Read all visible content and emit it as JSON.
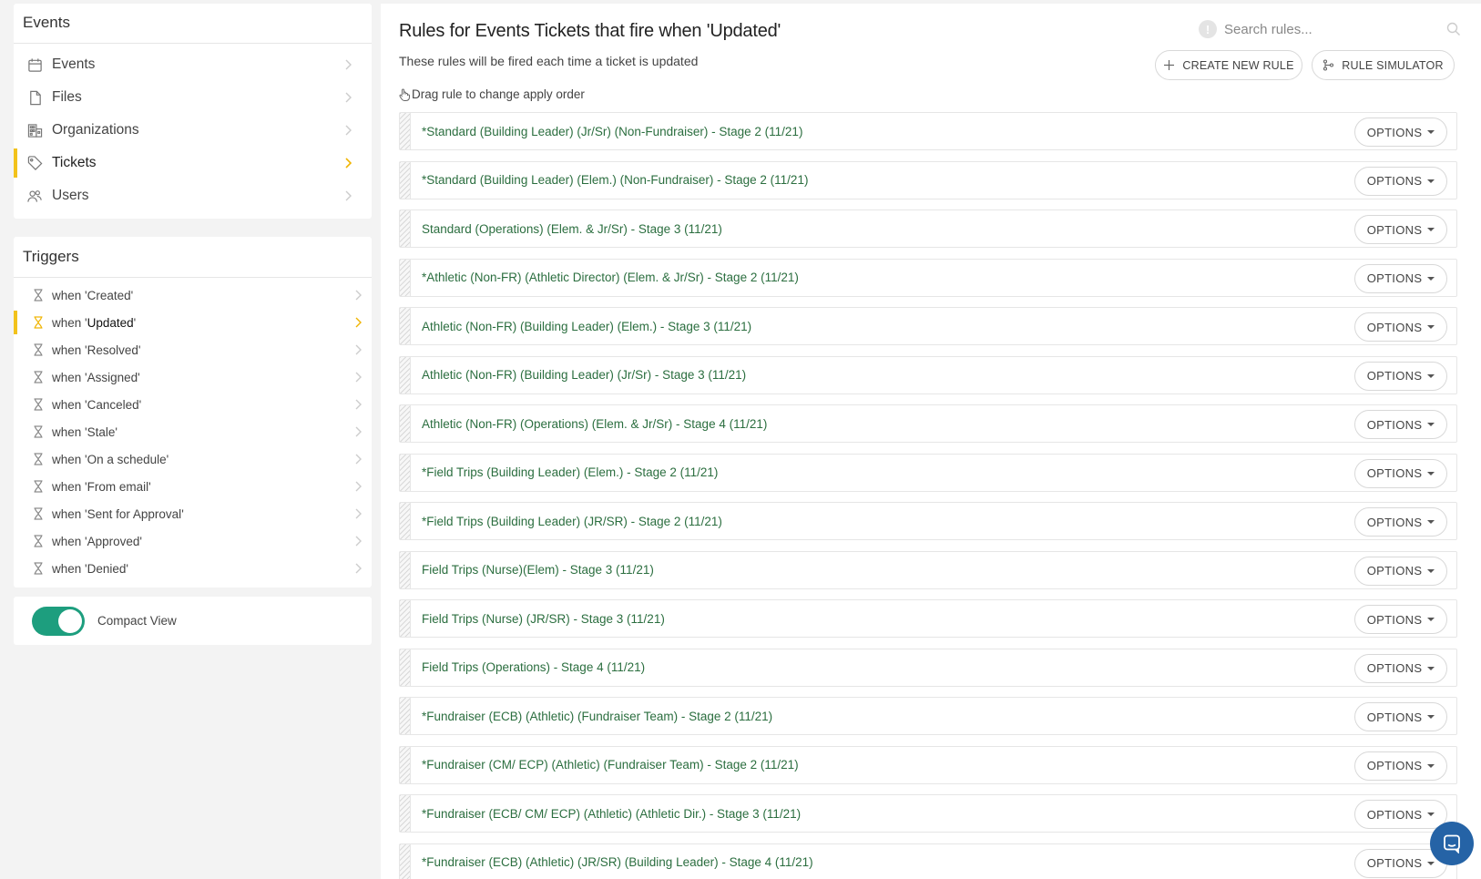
{
  "events_panel": {
    "title": "Events",
    "items": [
      {
        "label": "Events",
        "icon": "calendar-icon"
      },
      {
        "label": "Files",
        "icon": "file-icon"
      },
      {
        "label": "Organizations",
        "icon": "building-icon"
      },
      {
        "label": "Tickets",
        "icon": "tag-icon",
        "active": true
      },
      {
        "label": "Users",
        "icon": "users-icon"
      }
    ]
  },
  "triggers_panel": {
    "title": "Triggers",
    "prefix": "when",
    "items": [
      {
        "name": "Created"
      },
      {
        "name": "Updated",
        "active": true
      },
      {
        "name": "Resolved"
      },
      {
        "name": "Assigned"
      },
      {
        "name": "Canceled"
      },
      {
        "name": "Stale"
      },
      {
        "name": "On a schedule"
      },
      {
        "name": "From email"
      },
      {
        "name": "Sent for Approval"
      },
      {
        "name": "Approved"
      },
      {
        "name": "Denied"
      }
    ]
  },
  "compact_view": {
    "label": "Compact View",
    "enabled": true
  },
  "main": {
    "title": "Rules for Events Tickets that fire when 'Updated'",
    "subtitle": "These rules will be fired each time a ticket is updated",
    "drag_hint": "Drag rule to change apply order",
    "search_placeholder": "Search rules...",
    "create_button": "CREATE NEW RULE",
    "simulator_button": "RULE SIMULATOR",
    "options_label": "OPTIONS",
    "rules": [
      "*Standard (Building Leader) (Jr/Sr) (Non-Fundraiser) - Stage 2 (11/21)",
      "*Standard (Building Leader) (Elem.) (Non-Fundraiser) - Stage 2 (11/21)",
      "Standard (Operations) (Elem. & Jr/Sr) - Stage 3 (11/21)",
      "*Athletic (Non-FR) (Athletic Director) (Elem. & Jr/Sr) - Stage 2 (11/21)",
      "Athletic (Non-FR) (Building Leader) (Elem.) - Stage 3 (11/21)",
      "Athletic (Non-FR) (Building Leader) (Jr/Sr) - Stage 3 (11/21)",
      "Athletic (Non-FR) (Operations) (Elem. & Jr/Sr) - Stage 4 (11/21)",
      "*Field Trips (Building Leader) (Elem.) - Stage 2 (11/21)",
      "*Field Trips (Building Leader) (JR/SR) - Stage 2 (11/21)",
      "Field Trips (Nurse)(Elem) - Stage 3 (11/21)",
      "Field Trips (Nurse) (JR/SR) - Stage 3 (11/21)",
      "Field Trips (Operations) - Stage 4 (11/21)",
      "*Fundraiser (ECB) (Athletic) (Fundraiser Team) - Stage 2 (11/21)",
      "*Fundraiser (CM/ ECP) (Athletic) (Fundraiser Team) - Stage 2 (11/21)",
      "*Fundraiser (ECB/ CM/ ECP) (Athletic) (Athletic Dir.) - Stage 3 (11/21)",
      "*Fundraiser (ECB) (Athletic) (JR/SR) (Building Leader) - Stage 4 (11/21)"
    ]
  },
  "colors": {
    "accent": "#f2c21b",
    "rule_text": "#2b6e3f",
    "toggle_on": "#1d9e7e",
    "chat": "#2563a6"
  }
}
